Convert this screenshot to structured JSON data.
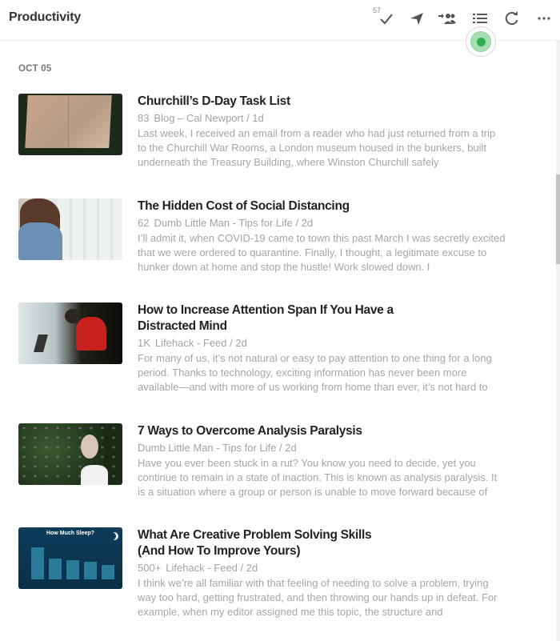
{
  "header": {
    "title": "Productivity",
    "toolbar": {
      "mark_read_count": "57",
      "icons": [
        "checkmark-icon",
        "send-icon",
        "share-people-icon",
        "list-view-icon",
        "refresh-icon",
        "more-icon"
      ]
    }
  },
  "status_indicator": {
    "color": "#2bb24c"
  },
  "feed": {
    "date_label": "OCT 05",
    "articles": [
      {
        "title": "Churchill’s D-Day Task List",
        "count": "83",
        "source": "Blog – Cal Newport / 1d",
        "snippet": "Last week, I received an email from a reader who had just returned from a trip to the Churchill War Rooms, a London museum housed in the bunkers, built underneath the Treasury Building, where Winston Churchill safely",
        "thumbnail": "open notebook"
      },
      {
        "title": "The Hidden Cost of Social Distancing",
        "count": "62",
        "source": "Dumb Little Man - Tips for Life / 2d",
        "snippet": "I’ll admit it, when COVID-19 came to town this past March I was secretly excited that we were ordered to quarantine. Finally, I thought, a legitimate excuse to hunker down at home and stop the hustle! Work slowed down. I",
        "thumbnail": "woman by window"
      },
      {
        "title": "How to Increase Attention Span If You Have a Distracted Mind",
        "count": "1K",
        "source": "Lifehack - Feed / 2d",
        "snippet": "For many of us, it’s not natural or easy to pay attention to one thing for a long period. Thanks to technology, exciting information has never been more available—and with more of us working from home than ever, it’s not hard to",
        "thumbnail": "man with laptop"
      },
      {
        "title": "7 Ways to Overcome Analysis Paralysis",
        "count": "",
        "source": "Dumb Little Man - Tips for Life / 2d",
        "snippet": "Have you ever been stuck in a rut? You know you need to decide, yet you continue to remain in a state of inaction. This is known as analysis paralysis. It is a situation where a group or person is unable to move forward because of",
        "thumbnail": "woman looking up"
      },
      {
        "title": "What Are Creative Problem Solving Skills (And How To Improve Yours)",
        "count": "500+",
        "source": "Lifehack - Feed / 2d",
        "snippet": "I think we’re all familiar with that feeling of needing to solve a problem, trying way too hard, getting frustrated, and then throwing our hands up in defeat. For example, when my editor assigned me this topic, the structure and",
        "thumbnail": "How Much Sleep? infographic",
        "thumbnail_text": "How Much Sleep?"
      }
    ]
  }
}
